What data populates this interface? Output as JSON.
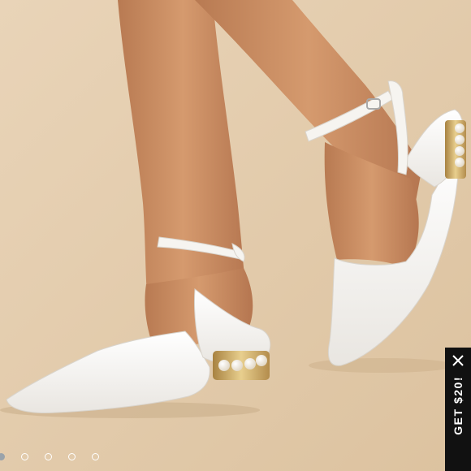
{
  "product_photo": {
    "alt_icon": "product-photo",
    "background_color": "#e3cbaa",
    "shoe_color": "#f7f5f1",
    "pearl_color": "#f3ead9",
    "heel_gold": "#c9a35c"
  },
  "carousel": {
    "count": 5,
    "active_index": 0
  },
  "promo": {
    "label": "GET $20!",
    "close_icon": "close-icon"
  }
}
